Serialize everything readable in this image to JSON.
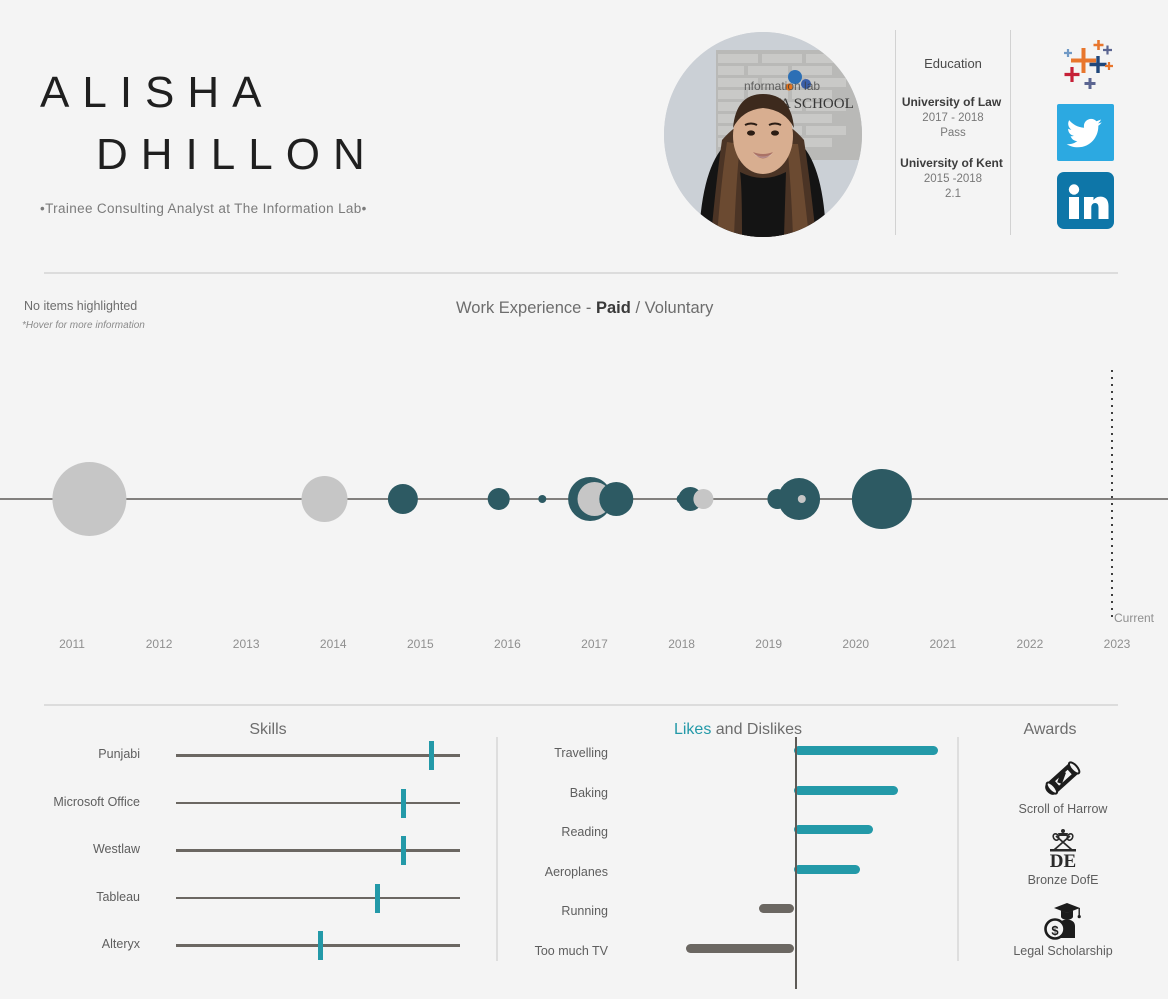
{
  "header": {
    "name_first": "ALISHA",
    "name_last": "DHILLON",
    "tagline": "•Trainee Consulting Analyst at The Information Lab•",
    "photo_alt": "portrait-photo"
  },
  "education": {
    "title": "Education",
    "entries": [
      {
        "school": "University of Law",
        "years": "2017 - 2018",
        "grade": "Pass"
      },
      {
        "school": "University of Kent",
        "years": "2015 -2018",
        "grade": "2.1"
      }
    ]
  },
  "socials": [
    {
      "name": "tableau-icon",
      "label": "Tableau"
    },
    {
      "name": "twitter-icon",
      "label": "Twitter"
    },
    {
      "name": "linkedin-icon",
      "label": "LinkedIn"
    }
  ],
  "work": {
    "highlight_note": "No items highlighted",
    "hover_note": "*Hover for more information",
    "title_prefix": "Work Experience - ",
    "title_paid": "Paid",
    "title_sep": " / ",
    "title_voluntary": "Voluntary",
    "current_label": "Current"
  },
  "colors": {
    "background": "#f4f4f4",
    "paid": "#2d5a63",
    "voluntary": "#c6c6c6",
    "accent": "#2399a8",
    "axis": "#5d5a56",
    "divider": "#dcdcdc",
    "text": "#5e5e5e"
  },
  "chart_data": [
    {
      "type": "scatter",
      "title": "Work Experience - Paid / Voluntary",
      "xlabel": "",
      "ylabel": "",
      "xlim": [
        2010.6,
        2023.4
      ],
      "grid": false,
      "legend": [
        "Paid",
        "Voluntary"
      ],
      "x_ticks": [
        "2011",
        "2012",
        "2013",
        "2014",
        "2015",
        "2016",
        "2017",
        "2018",
        "2019",
        "2020",
        "2021",
        "2022",
        "2023"
      ],
      "annotations": [
        {
          "label": "Current",
          "x": 2022.9
        }
      ],
      "points": [
        {
          "x": 2011.2,
          "r": 37,
          "type": "Voluntary"
        },
        {
          "x": 2013.9,
          "r": 23,
          "type": "Voluntary"
        },
        {
          "x": 2014.8,
          "r": 15,
          "type": "Paid"
        },
        {
          "x": 2015.9,
          "r": 11,
          "type": "Paid"
        },
        {
          "x": 2016.4,
          "r": 4,
          "type": "Paid"
        },
        {
          "x": 2016.95,
          "r": 22,
          "type": "Paid"
        },
        {
          "x": 2017.0,
          "r": 17,
          "type": "Voluntary"
        },
        {
          "x": 2017.25,
          "r": 17,
          "type": "Paid"
        },
        {
          "x": 2018.0,
          "r": 5,
          "type": "Paid"
        },
        {
          "x": 2018.1,
          "r": 12,
          "type": "Paid"
        },
        {
          "x": 2018.25,
          "r": 10,
          "type": "Voluntary"
        },
        {
          "x": 2019.1,
          "r": 10,
          "type": "Paid"
        },
        {
          "x": 2019.35,
          "r": 21,
          "type": "Paid"
        },
        {
          "x": 2019.38,
          "r": 4,
          "type": "Voluntary"
        },
        {
          "x": 2020.3,
          "r": 30,
          "type": "Paid"
        }
      ]
    },
    {
      "type": "bar",
      "title": "Skills",
      "orientation": "horizontal",
      "categories": [
        "Punjabi",
        "Microsoft Office",
        "Westlaw",
        "Tableau",
        "Alteryx"
      ],
      "values": [
        90,
        80,
        80,
        71,
        51
      ],
      "xlim": [
        0,
        100
      ],
      "ylabel": "",
      "xlabel": "",
      "grid": false
    },
    {
      "type": "bar",
      "title": "Likes and Dislikes",
      "orientation": "horizontal",
      "categories": [
        "Travelling",
        "Baking",
        "Reading",
        "Aeroplanes",
        "Running",
        "Too much TV"
      ],
      "values": [
        100,
        72,
        55,
        46,
        -24,
        -75
      ],
      "xlim": [
        -100,
        110
      ],
      "ylabel": "",
      "xlabel": "",
      "grid": false,
      "legend": [
        "Likes",
        "Dislikes"
      ]
    }
  ],
  "skills": {
    "title": "Skills",
    "items": [
      {
        "label": "Punjabi",
        "value": 90
      },
      {
        "label": "Microsoft Office",
        "value": 80
      },
      {
        "label": "Westlaw",
        "value": 80
      },
      {
        "label": "Tableau",
        "value": 71
      },
      {
        "label": "Alteryx",
        "value": 51
      }
    ]
  },
  "likes": {
    "title_likes": "Likes",
    "title_rest": " and Dislikes",
    "items": [
      {
        "label": "Travelling",
        "value": 100
      },
      {
        "label": "Baking",
        "value": 72
      },
      {
        "label": "Reading",
        "value": 55
      },
      {
        "label": "Aeroplanes",
        "value": 46
      },
      {
        "label": "Running",
        "value": -24
      },
      {
        "label": "Too much TV",
        "value": -75
      }
    ]
  },
  "awards": {
    "title": "Awards",
    "items": [
      {
        "label": "Scroll of Harrow",
        "icon": "scroll-icon"
      },
      {
        "label": "Bronze DofE",
        "icon": "dofe-icon"
      },
      {
        "label": "Legal Scholarship",
        "icon": "scholarship-icon"
      }
    ]
  }
}
